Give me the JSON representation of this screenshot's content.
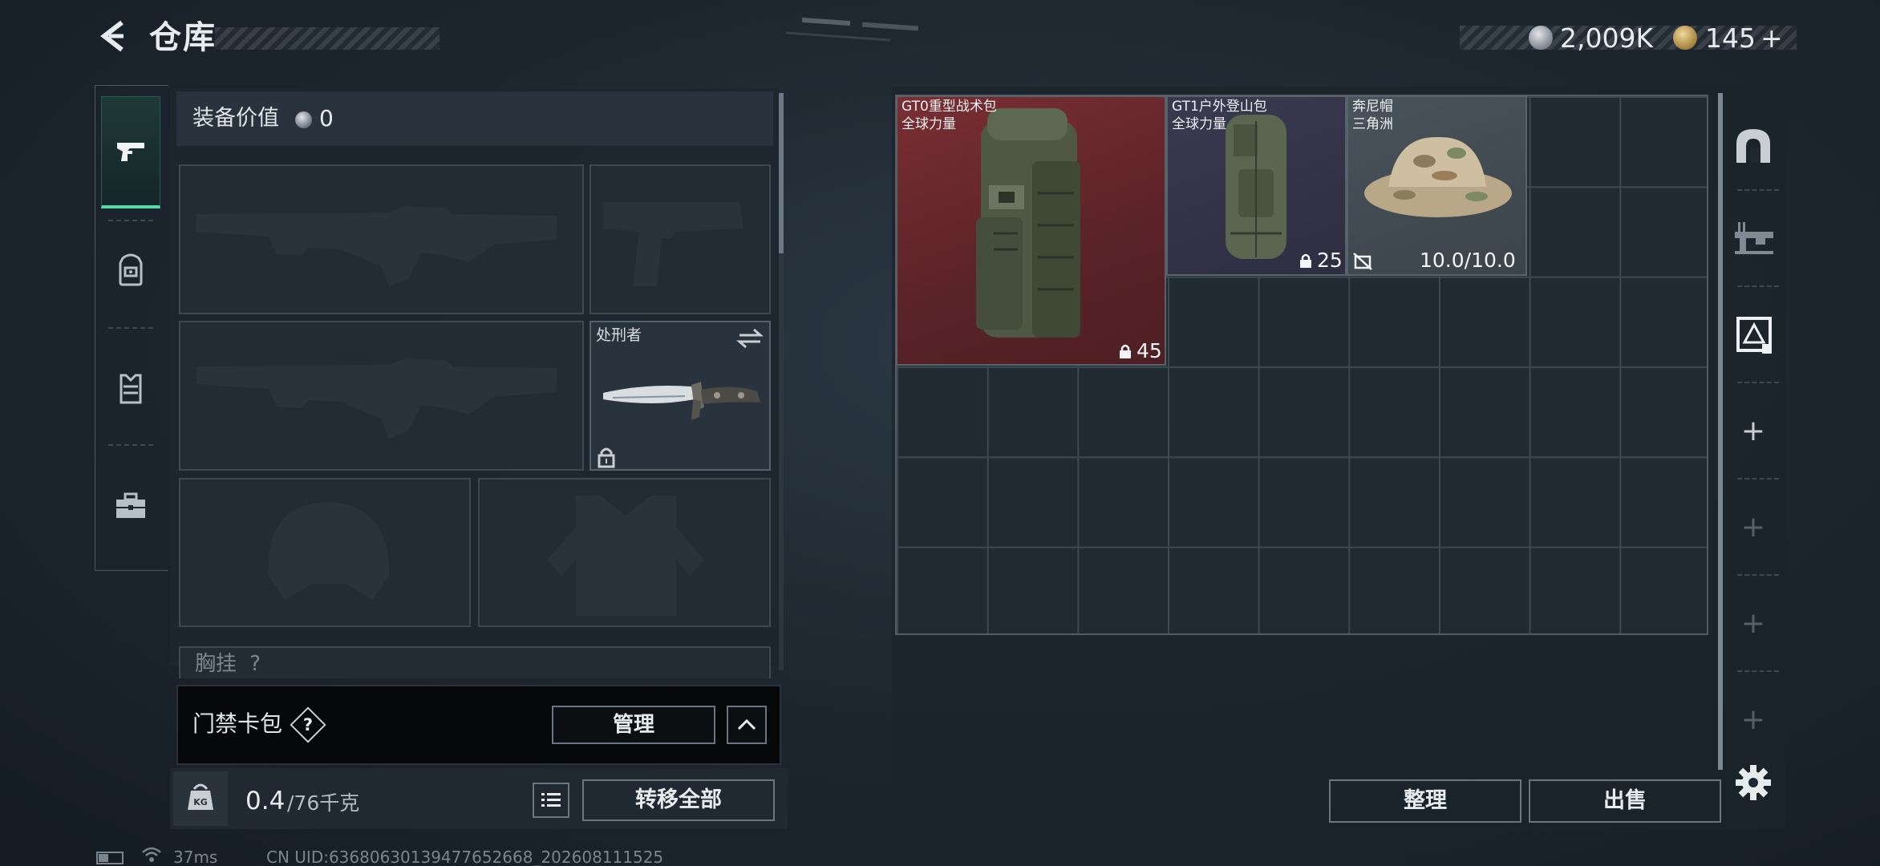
{
  "header": {
    "title": "仓库",
    "currency_primary": "2,009K",
    "currency_secondary": "145",
    "currency_secondary_add": "+"
  },
  "left_tabs": [
    {
      "id": "weapons",
      "icon": "pistol-icon",
      "selected": true
    },
    {
      "id": "backpack",
      "icon": "backpack-icon",
      "selected": false
    },
    {
      "id": "vest",
      "icon": "vest-icon",
      "selected": false
    },
    {
      "id": "case",
      "icon": "case-icon",
      "selected": false
    }
  ],
  "equipment": {
    "value_label": "装备价值",
    "value": "0",
    "melee_name": "处刑者",
    "chest_label": "胸挂",
    "chest_help": "?"
  },
  "keycard": {
    "label": "门禁卡包",
    "help": "?",
    "manage_label": "管理"
  },
  "bottom": {
    "weight_current": "0.4",
    "weight_max": "/76千克",
    "transfer_all": "转移全部"
  },
  "warehouse_items": [
    {
      "name": "GT0重型战术包",
      "subtitle": "全球力量",
      "capacity": "45",
      "rarity_color": "#7a2e33"
    },
    {
      "name": "GT1户外登山包",
      "subtitle": "全球力量",
      "capacity": "25",
      "rarity_color": "#3a3950"
    },
    {
      "name": "奔尼帽",
      "subtitle": "三角洲",
      "durability": "10.0/10.0",
      "rarity_color": "#4a525b"
    }
  ],
  "right_tools": {
    "plus": "+"
  },
  "actions": {
    "sort": "整理",
    "sell": "出售"
  },
  "status": {
    "ping": "37ms",
    "uid": "CN UID:6368063013947765266​8_202608111525"
  }
}
